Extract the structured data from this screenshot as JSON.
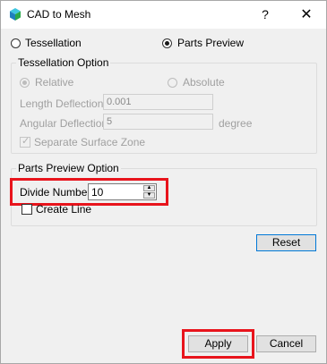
{
  "window": {
    "title": "CAD to Mesh",
    "help_label": "?",
    "close_label": "✕"
  },
  "mode": {
    "tessellation_label": "Tessellation",
    "parts_preview_label": "Parts Preview",
    "selected": "Parts Preview"
  },
  "tessellation_option": {
    "legend": "Tessellation Option",
    "relative_label": "Relative",
    "absolute_label": "Absolute",
    "length_deflection_label": "Length Deflection",
    "length_deflection_value": "0.001",
    "angular_deflection_label": "Angular Deflection",
    "angular_deflection_value": "5",
    "angular_unit": "degree",
    "separate_surface_zone_label": "Separate Surface Zone",
    "separate_surface_zone_checked": true
  },
  "parts_preview_option": {
    "legend": "Parts Preview Option",
    "divide_number_label": "Divide Number",
    "divide_number_value": "10",
    "create_line_label": "Create Line",
    "create_line_checked": false
  },
  "buttons": {
    "reset": "Reset",
    "apply": "Apply",
    "cancel": "Cancel"
  },
  "colors": {
    "highlight": "#e8141c",
    "focus_border": "#0078d7"
  },
  "icons": {
    "app": "cad-mesh-cube-icon"
  }
}
